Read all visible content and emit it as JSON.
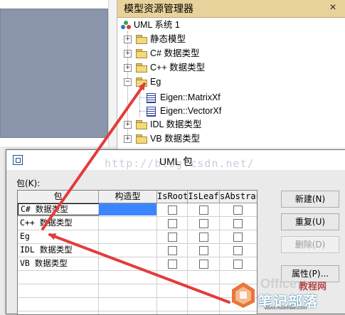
{
  "explorer": {
    "title": "模型资源管理器",
    "close_glyph": "×",
    "root": "UML 系统 1",
    "items": [
      {
        "label": "静态模型",
        "expander": "+",
        "icon": "folder-icon"
      },
      {
        "label": "C# 数据类型",
        "expander": "+",
        "icon": "folder-icon"
      },
      {
        "label": "C++ 数据类型",
        "expander": "+",
        "icon": "folder-icon"
      },
      {
        "label": "Eg",
        "expander": "−",
        "icon": "folder-open-icon",
        "children": [
          {
            "label": "Eigen::MatrixXf",
            "icon": "class-icon"
          },
          {
            "label": "Eigen::VectorXf",
            "icon": "class-icon"
          }
        ]
      },
      {
        "label": "IDL 数据类型",
        "expander": "+",
        "icon": "folder-icon"
      },
      {
        "label": "VB 数据类型",
        "expander": "+",
        "icon": "folder-icon"
      }
    ]
  },
  "dialog": {
    "title": "UML 包",
    "package_label": "包(K):",
    "columns": [
      "包",
      "构造型",
      "IsRoot",
      "IsLeaf",
      "sAbstract"
    ],
    "rows": [
      {
        "name": "C# 数据类型",
        "is_root": false,
        "is_leaf": false,
        "is_abstract": false
      },
      {
        "name": "C++ 数据类型",
        "is_root": false,
        "is_leaf": false,
        "is_abstract": false
      },
      {
        "name": "Eg",
        "is_root": false,
        "is_leaf": false,
        "is_abstract": false
      },
      {
        "name": "IDL 数据类型",
        "is_root": false,
        "is_leaf": false,
        "is_abstract": false
      },
      {
        "name": "VB 数据类型",
        "is_root": false,
        "is_leaf": false,
        "is_abstract": false
      }
    ],
    "buttons": {
      "new": "新建(N)",
      "rename": "重复(U)",
      "delete": "删除(D)",
      "properties": "属性(P)..."
    }
  },
  "watermark": "http://blog.csdn.net/",
  "logo": {
    "office": "Office",
    "brand": "笔记部落",
    "net": "教程网",
    "url": "www.notetribe.com"
  },
  "colors": {
    "explorer_title_bg": "#e8d29b",
    "selection": "#3b86ff",
    "arrow": "#e23c3c"
  }
}
